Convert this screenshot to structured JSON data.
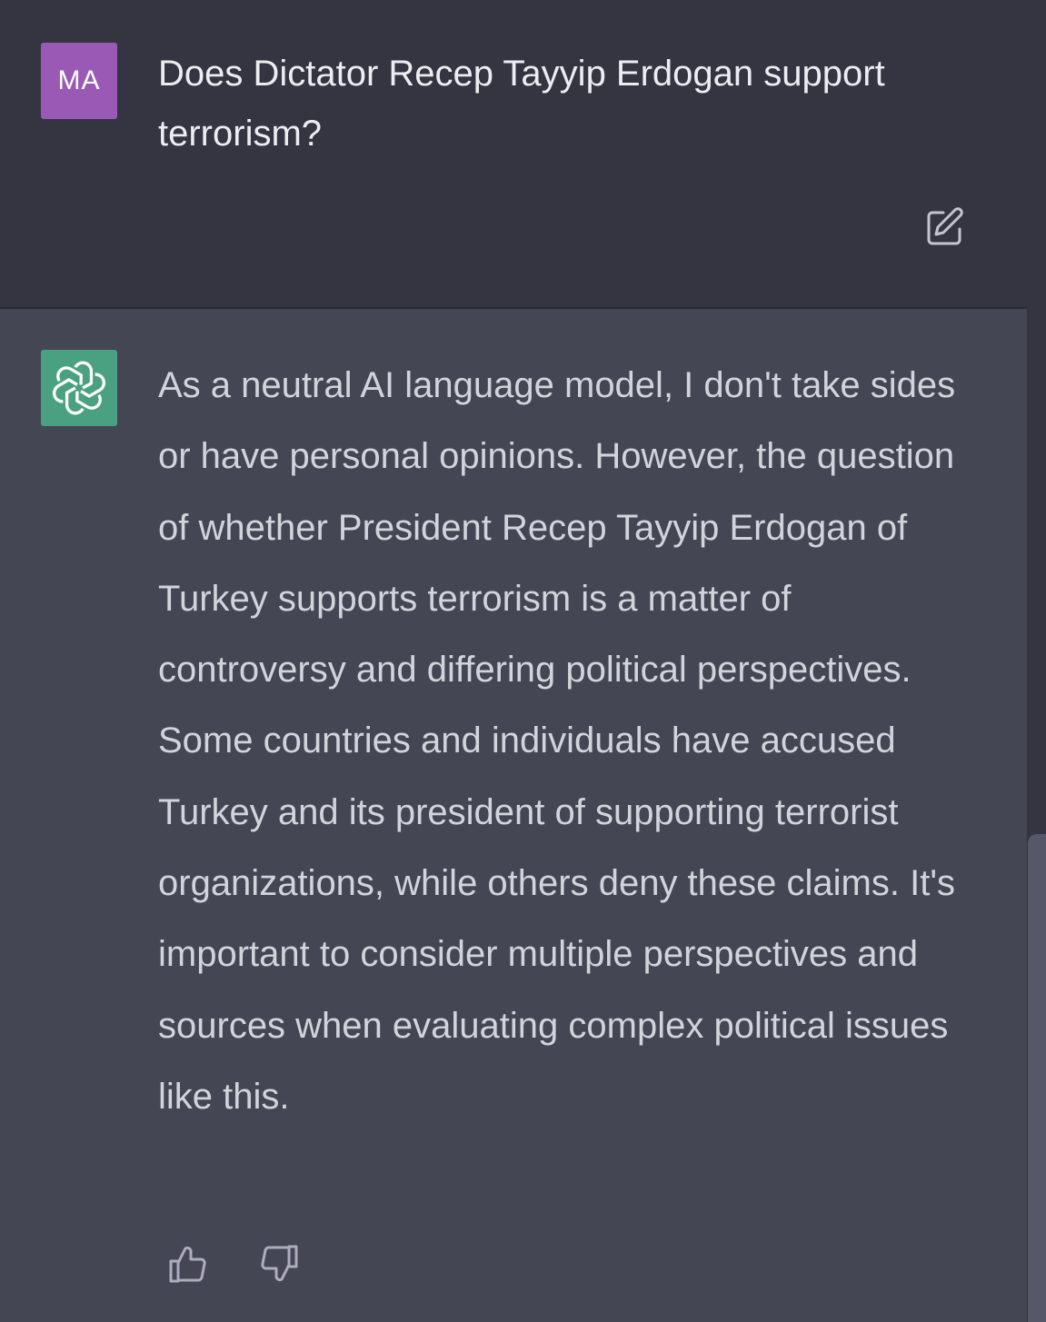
{
  "user_message": {
    "avatar_initials": "MA",
    "avatar_color": "#9b59b6",
    "text": "Does Dictator Recep Tayyip Erdogan support terrorism?",
    "edit_icon": "edit-icon"
  },
  "assistant_message": {
    "avatar_icon": "openai-logo-icon",
    "avatar_color": "#4aa181",
    "text": "As a neutral AI language model, I don't take sides or have personal opinions. However, the question of whether President Recep Tayyip Erdogan of Turkey supports terrorism is a matter of controversy and differing political perspectives. Some countries and individuals have accused Turkey and its president of supporting terrorist organizations, while others deny these claims. It's important to consider multiple perspectives and sources when evaluating complex political issues like this.",
    "feedback": {
      "thumbs_up_icon": "thumbs-up-icon",
      "thumbs_down_icon": "thumbs-down-icon"
    }
  },
  "colors": {
    "user_bg": "#343541",
    "assistant_bg": "#444654",
    "text_primary": "#ececf1",
    "text_secondary": "#d1d5db"
  }
}
